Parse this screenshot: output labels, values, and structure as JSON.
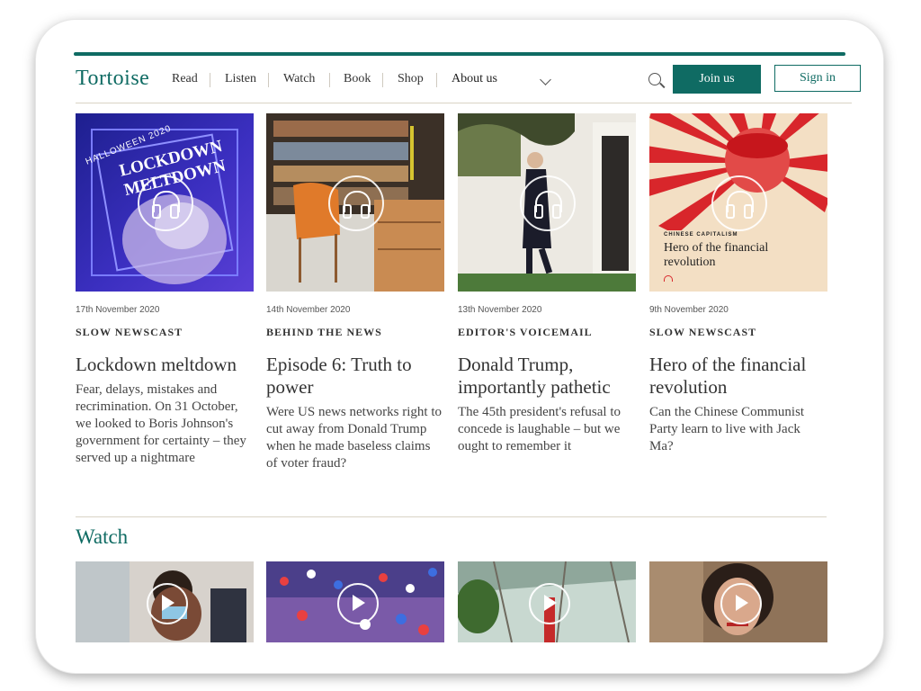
{
  "brand": {
    "logo": "Tortoise"
  },
  "nav": {
    "items": [
      "Read",
      "Listen",
      "Watch",
      "Book",
      "Shop"
    ],
    "about": "About us",
    "join": "Join us",
    "signin": "Sign in"
  },
  "colors": {
    "accent": "#0f6b63",
    "background": "#ffffff"
  },
  "cards": [
    {
      "date": "17th November 2020",
      "category": "SLOW NEWSCAST",
      "title": "Lockdown meltdown",
      "description": "Fear, delays, mistakes and recrimination. On 31 October, we looked to Boris Johnson's government for certainty – they served up a nightmare",
      "art_text_top": "HALLOWEEN 2020",
      "art_text_main": "LOCKDOWN MELTDOWN",
      "icon": "headphones-icon"
    },
    {
      "date": "14th November 2020",
      "category": "BEHIND THE NEWS",
      "title": "Episode 6: Truth to power",
      "description": "Were US news networks right to cut away from Donald Trump when he made baseless claims of voter fraud?",
      "icon": "headphones-icon"
    },
    {
      "date": "13th November 2020",
      "category": "EDITOR'S VOICEMAIL",
      "title": "Donald Trump, importantly pathetic",
      "description": "The 45th president's refusal to concede is laughable – but we ought to remember it",
      "icon": "headphones-icon"
    },
    {
      "date": "9th November 2020",
      "category": "SLOW NEWSCAST",
      "title": "Hero of the financial revolution",
      "description": "Can the Chinese Communist Party learn to live with Jack Ma?",
      "art_kicker": "CHINESE CAPITALISM",
      "art_title": "Hero of the financial revolution",
      "icon": "headphones-icon"
    }
  ],
  "watch": {
    "title": "Watch",
    "videos": [
      {
        "icon": "play-icon"
      },
      {
        "icon": "play-icon"
      },
      {
        "icon": "play-icon"
      },
      {
        "icon": "play-icon"
      }
    ]
  }
}
